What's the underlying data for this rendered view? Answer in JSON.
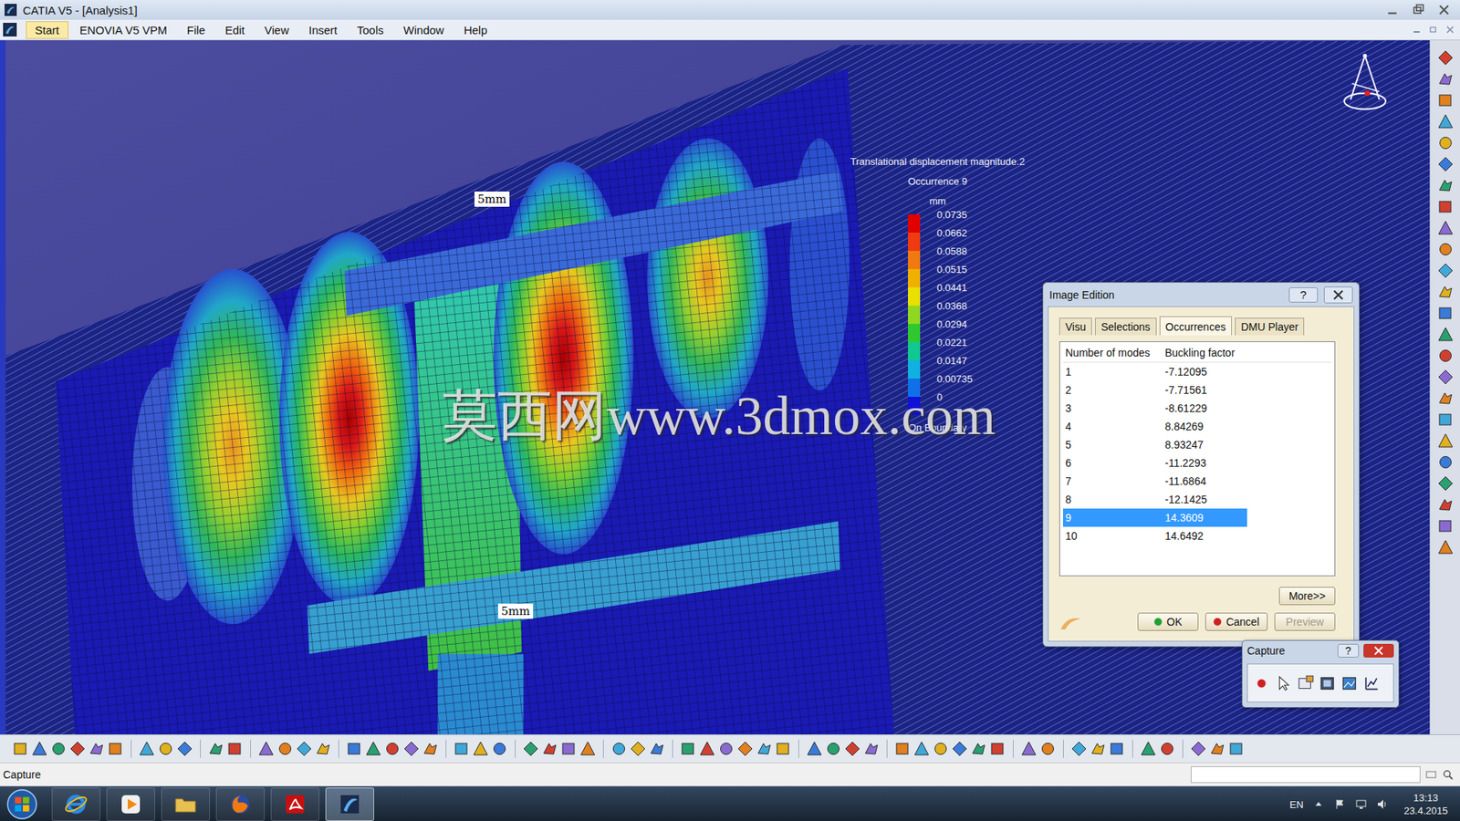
{
  "window": {
    "title": "CATIA V5 - [Analysis1]"
  },
  "menu": [
    {
      "label": "Start",
      "selected": true
    },
    {
      "label": "ENOVIA V5 VPM",
      "selected": false
    },
    {
      "label": "File",
      "selected": false
    },
    {
      "label": "Edit",
      "selected": false
    },
    {
      "label": "View",
      "selected": false
    },
    {
      "label": "Insert",
      "selected": false
    },
    {
      "label": "Tools",
      "selected": false
    },
    {
      "label": "Window",
      "selected": false
    },
    {
      "label": "Help",
      "selected": false
    }
  ],
  "viewport": {
    "dimension_labels": [
      "5mm",
      "5mm"
    ],
    "watermark": "莫西网www.3dmox.com"
  },
  "legend": {
    "title": "Translational displacement magnitude.2",
    "occurrence": "Occurrence 9",
    "unit": "mm",
    "scale": [
      {
        "value": "0.0735",
        "color": "#e00000"
      },
      {
        "value": "0.0662",
        "color": "#f03a10"
      },
      {
        "value": "0.0588",
        "color": "#f07a10"
      },
      {
        "value": "0.0515",
        "color": "#f0b000"
      },
      {
        "value": "0.0441",
        "color": "#e8e000"
      },
      {
        "value": "0.0368",
        "color": "#90d820"
      },
      {
        "value": "0.0294",
        "color": "#30c830"
      },
      {
        "value": "0.0221",
        "color": "#10c890"
      },
      {
        "value": "0.0147",
        "color": "#10b0e0"
      },
      {
        "value": "0.00735",
        "color": "#1070e8"
      },
      {
        "value": "0",
        "color": "#1010d8"
      }
    ],
    "footer": "On Boundary"
  },
  "dialog": {
    "title": "Image Edition",
    "help": "?",
    "tabs": [
      {
        "label": "Visu",
        "selected": false
      },
      {
        "label": "Selections",
        "selected": false
      },
      {
        "label": "Occurrences",
        "selected": true
      },
      {
        "label": "DMU Player",
        "selected": false
      }
    ],
    "table": {
      "columns": [
        "Number of modes",
        "Buckling factor"
      ],
      "rows": [
        {
          "mode": "1",
          "factor": "-7.12095",
          "selected": false
        },
        {
          "mode": "2",
          "factor": "-7.71561",
          "selected": false
        },
        {
          "mode": "3",
          "factor": "-8.61229",
          "selected": false
        },
        {
          "mode": "4",
          "factor": "8.84269",
          "selected": false
        },
        {
          "mode": "5",
          "factor": "8.93247",
          "selected": false
        },
        {
          "mode": "6",
          "factor": "-11.2293",
          "selected": false
        },
        {
          "mode": "7",
          "factor": "-11.6864",
          "selected": false
        },
        {
          "mode": "8",
          "factor": "-12.1425",
          "selected": false
        },
        {
          "mode": "9",
          "factor": "14.3609",
          "selected": true
        },
        {
          "mode": "10",
          "factor": "14.6492",
          "selected": false
        }
      ]
    },
    "more_button": "More>>",
    "buttons": [
      {
        "label": "OK",
        "kind": "ok",
        "disabled": false
      },
      {
        "label": "Cancel",
        "kind": "cancel",
        "disabled": false
      },
      {
        "label": "Preview",
        "kind": "plain",
        "disabled": true
      }
    ]
  },
  "capture": {
    "title": "Capture",
    "help": "?"
  },
  "status_bar": {
    "text": "Capture"
  },
  "taskbar": {
    "language": "EN",
    "time": "13:13",
    "date": "23.4.2015"
  }
}
